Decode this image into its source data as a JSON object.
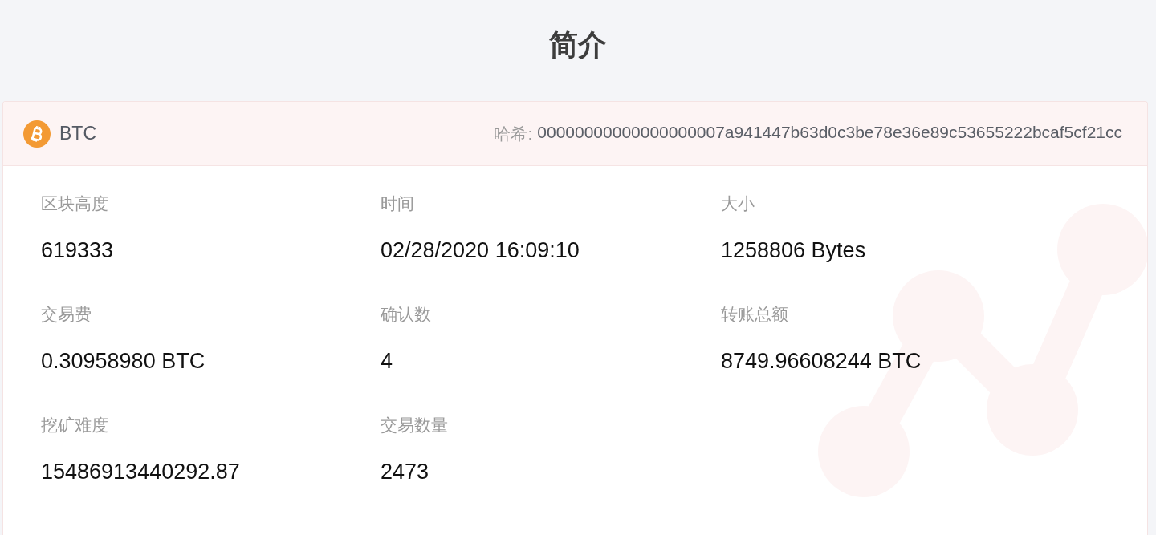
{
  "page": {
    "title": "简介"
  },
  "block": {
    "coin": "BTC",
    "hash_label": "哈希:",
    "hash": "00000000000000000007a941447b63d0c3be78e36e89c53655222bcaf5cf21cc",
    "fields": [
      {
        "label": "区块高度",
        "value": "619333"
      },
      {
        "label": "时间",
        "value": "02/28/2020 16:09:10"
      },
      {
        "label": "大小",
        "value": "1258806 Bytes"
      },
      {
        "label": "交易费",
        "value": "0.30958980 BTC"
      },
      {
        "label": "确认数",
        "value": "4"
      },
      {
        "label": "转账总额",
        "value": "8749.96608244 BTC"
      },
      {
        "label": "挖矿难度",
        "value": "15486913440292.87"
      },
      {
        "label": "交易数量",
        "value": "2473"
      }
    ]
  }
}
